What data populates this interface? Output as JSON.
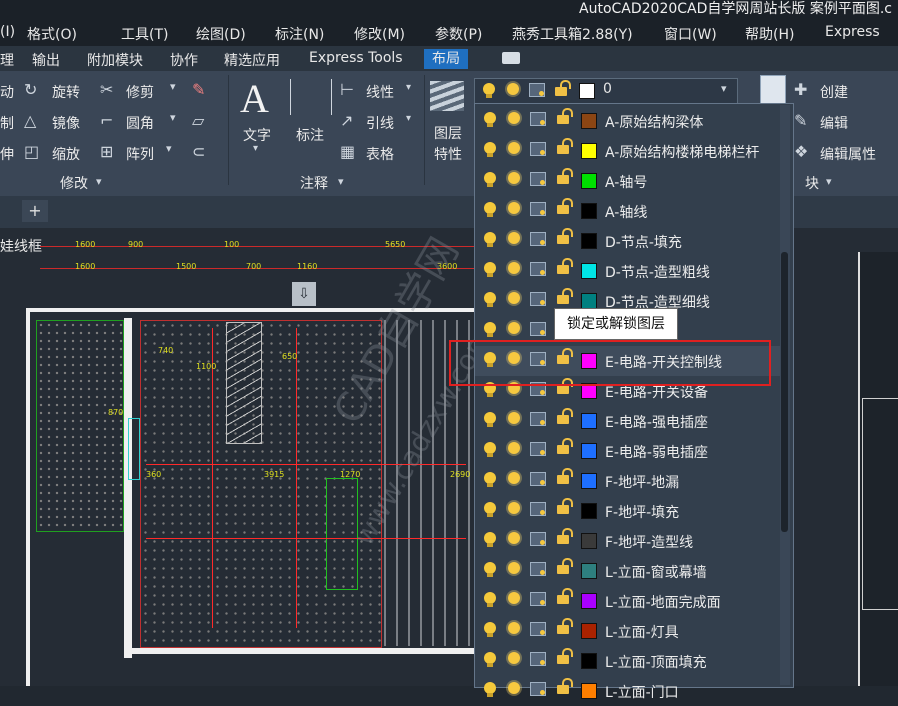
{
  "window": {
    "title": "AutoCAD2020CAD自学网周站长版    案例平面图.c"
  },
  "menubar": [
    "(I)",
    "格式(O)",
    "工具(T)",
    "绘图(D)",
    "标注(N)",
    "修改(M)",
    "参数(P)",
    "燕秀工具箱2.88(Y)",
    "窗口(W)",
    "帮助(H)",
    "Express"
  ],
  "tabs": [
    "理",
    "输出",
    "附加模块",
    "协作",
    "精选应用",
    "Express Tools",
    "布局"
  ],
  "ribbon": {
    "modify": {
      "col1": [
        "动",
        "制",
        "伸"
      ],
      "items": [
        "旋转",
        "镜像",
        "缩放",
        "修剪",
        "圆角",
        "阵列"
      ],
      "title": "修改"
    },
    "annotation": {
      "text": "文字",
      "dim": "标注",
      "items": [
        "线性",
        "引线",
        "表格"
      ],
      "title": "注释"
    },
    "layers": {
      "label1": "图层",
      "label2": "特性"
    },
    "block": {
      "items": [
        "创建",
        "编辑",
        "编辑属性"
      ],
      "title": "块"
    }
  },
  "layer_combo": {
    "value": "0",
    "color": "#ffffff"
  },
  "layers": [
    {
      "name": "A-原始结构梁体",
      "color": "#8b4513"
    },
    {
      "name": "A-原始结构楼梯电梯栏杆",
      "color": "#ffff00"
    },
    {
      "name": "A-轴号",
      "color": "#00e000"
    },
    {
      "name": "A-轴线",
      "color": "#000000"
    },
    {
      "name": "D-节点-填充",
      "color": "#000000"
    },
    {
      "name": "D-节点-造型粗线",
      "color": "#00e5e5"
    },
    {
      "name": "D-节点-造型细线",
      "color": "#008080"
    },
    {
      "name": "",
      "color": "#333f4d"
    },
    {
      "name": "E-电路-开关控制线",
      "color": "#ff00ff"
    },
    {
      "name": "E-电路-开关设备",
      "color": "#ff00ff"
    },
    {
      "name": "E-电路-强电插座",
      "color": "#1e6fff"
    },
    {
      "name": "E-电路-弱电插座",
      "color": "#1e6fff"
    },
    {
      "name": "F-地坪-地漏",
      "color": "#1e6fff"
    },
    {
      "name": "F-地坪-填充",
      "color": "#000000"
    },
    {
      "name": "F-地坪-造型线",
      "color": "#3a3a3a"
    },
    {
      "name": "L-立面-窗或幕墙",
      "color": "#2e7f7f"
    },
    {
      "name": "L-立面-地面完成面",
      "color": "#aa00ff"
    },
    {
      "name": "L-立面-灯具",
      "color": "#aa2200"
    },
    {
      "name": "L-立面-顶面填充",
      "color": "#000000"
    },
    {
      "name": "L-立面-门口",
      "color": "#ff7f00"
    }
  ],
  "tooltip": "锁定或解锁图层",
  "drawing": {
    "label": "娃线框",
    "dims": [
      "1600",
      "900",
      "100",
      "5650",
      "1600",
      "1500",
      "700",
      "1160",
      "3600",
      "740",
      "1100",
      "650",
      "870",
      "3915",
      "1270",
      "2690",
      "360"
    ]
  },
  "watermark": [
    "CAD自学网",
    "www.cadzxw.com"
  ]
}
